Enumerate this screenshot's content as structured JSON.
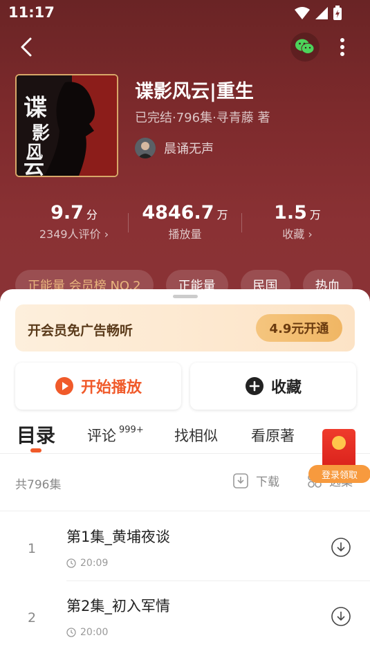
{
  "status": {
    "time": "11:17"
  },
  "book": {
    "title": "谍影风云|重生",
    "meta": "已完结·796集·寻青藤 著",
    "narrator": "晨诵无声",
    "cover_text": "谍影风云"
  },
  "stats": [
    {
      "value": "9.7",
      "unit": "分",
      "label": "2349人评价"
    },
    {
      "value": "4846.7",
      "unit": "万",
      "label": "播放量"
    },
    {
      "value": "1.5",
      "unit": "万",
      "label": "收藏"
    }
  ],
  "tags": [
    "正能量 会员榜 NO.2",
    "正能量",
    "民国",
    "热血"
  ],
  "vip": {
    "text": "开会员免广告畅听",
    "button": "4.9元开通"
  },
  "actions": {
    "play": "开始播放",
    "favorite": "收藏"
  },
  "tabs": [
    {
      "label": "目录"
    },
    {
      "label": "评论",
      "sup": "999+"
    },
    {
      "label": "找相似"
    },
    {
      "label": "看原著"
    }
  ],
  "redpacket": {
    "label": "登录领取"
  },
  "list": {
    "count": "共796集",
    "download": "下载",
    "select": "选集",
    "episodes": [
      {
        "index": "1",
        "title": "第1集_黄埔夜谈",
        "duration": "20:09"
      },
      {
        "index": "2",
        "title": "第2集_初入军情",
        "duration": "20:00"
      }
    ]
  },
  "colors": {
    "accent": "#f05a2a",
    "hero_bg": "#7d2a2c",
    "tag_gold": "#e9b57e"
  }
}
